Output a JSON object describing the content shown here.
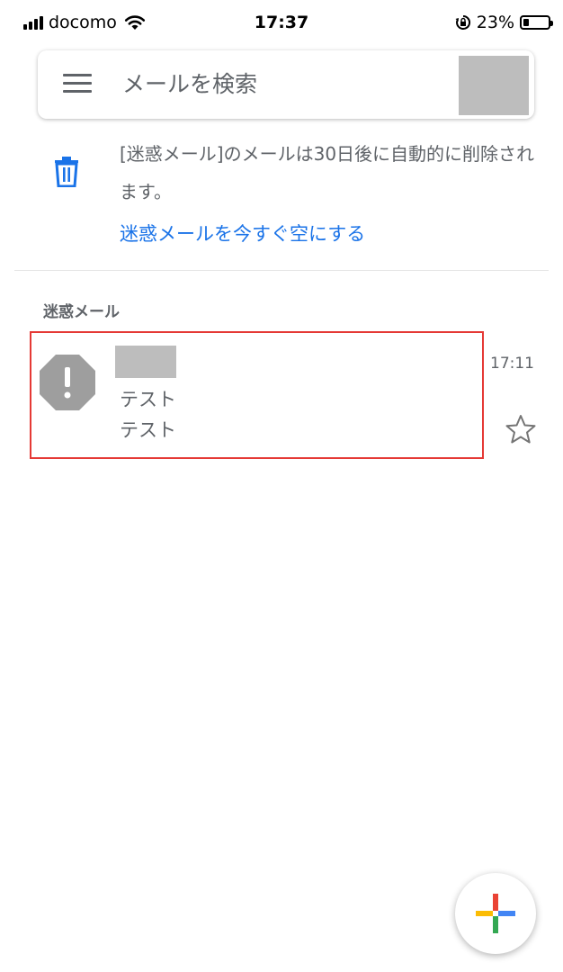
{
  "status_bar": {
    "carrier": "docomo",
    "time": "17:37",
    "battery_percent": "23%",
    "battery_level": 0.23
  },
  "search": {
    "placeholder": "メールを検索"
  },
  "info_banner": {
    "message": "[迷惑メール]のメールは30日後に自動的に削除されます。",
    "empty_link": "迷惑メールを今すぐ空にする"
  },
  "section": {
    "label": "迷惑メール"
  },
  "mail_list": [
    {
      "subject": "テスト",
      "snippet": "テスト",
      "time": "17:11",
      "starred": false
    }
  ],
  "colors": {
    "accent": "#1a73e8",
    "highlight": "#e53935",
    "spam_icon": "#9e9e9e",
    "fab_blue": "#4285f4",
    "fab_red": "#ea4335",
    "fab_yellow": "#fbbc04",
    "fab_green": "#34a853"
  },
  "icons": {
    "menu": "hamburger-menu-icon",
    "trash": "trash-icon",
    "spam": "spam-octagon-icon",
    "star": "star-outline-icon",
    "compose": "compose-plus-icon"
  }
}
